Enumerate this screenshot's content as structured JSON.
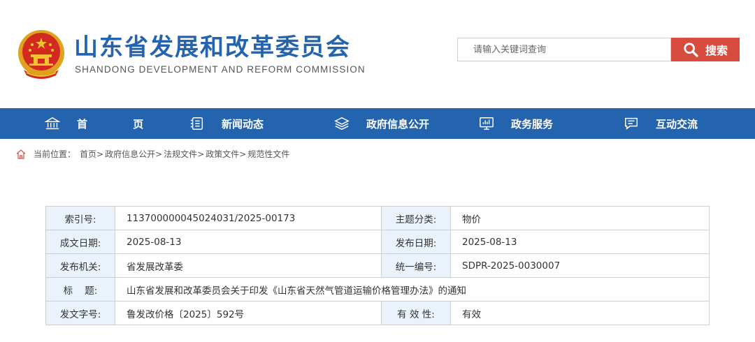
{
  "header": {
    "title_cn": "山东省发展和改革委员会",
    "title_en": "SHANDONG DEVELOPMENT AND REFORM COMMISSION"
  },
  "search": {
    "placeholder": "请输入关键词查询",
    "button_label": "搜索"
  },
  "nav": {
    "items": [
      {
        "label": "首 页",
        "icon": "home-temple-icon"
      },
      {
        "label": "新闻动态",
        "icon": "news-list-icon"
      },
      {
        "label": "政府信息公开",
        "icon": "layers-icon"
      },
      {
        "label": "政务服务",
        "icon": "monitor-icon"
      },
      {
        "label": "互动交流",
        "icon": "chat-bubble-icon"
      }
    ]
  },
  "breadcrumb": {
    "prefix": "当前位置：",
    "items": [
      "首页",
      "政府信息公开",
      "法规文件",
      "政策文件",
      "规范性文件"
    ]
  },
  "info_table": {
    "rows": [
      {
        "label1": "索引号:",
        "value1": "113700000045024031/2025-00173",
        "label2": "主题分类:",
        "value2": "物价"
      },
      {
        "label1": "成文日期:",
        "value1": "2025-08-13",
        "label2": "发布日期:",
        "value2": "2025-08-13"
      },
      {
        "label1": "发布机关:",
        "value1": "省发展改革委",
        "label2": "统一编号:",
        "value2": "SDPR-2025-0030007"
      },
      {
        "label1": "标    题:",
        "value1": "山东省发展和改革委员会关于印发《山东省天然气管道运输价格管理办法》的通知"
      },
      {
        "label1": "发文字号:",
        "value1": "鲁发改价格〔2025〕592号",
        "label2": "有 效 性:",
        "value2": "有效"
      }
    ]
  },
  "colors": {
    "brand_blue": "#2463ad",
    "accent_red": "#d74c3e",
    "label_bg": "#eaf3fb"
  }
}
